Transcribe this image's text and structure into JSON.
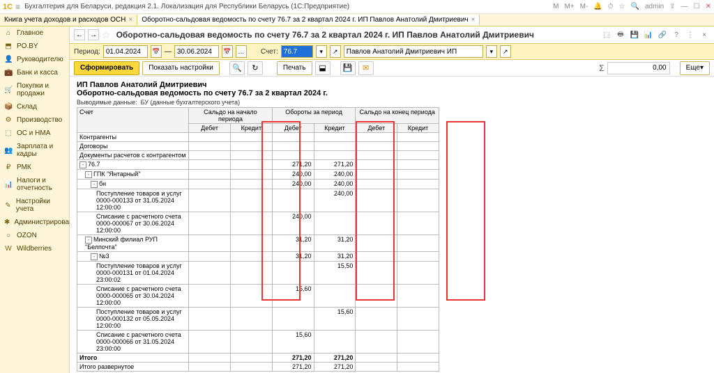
{
  "app": {
    "title": "Бухгалтерия для Беларуси, редакция 2.1. Локализация для Республики Беларусь   (1С:Предприятие)",
    "user": "admin",
    "m_labels": [
      "M",
      "M+",
      "M-"
    ]
  },
  "tabs": [
    {
      "label": "Книга учета доходов и расходов ОСН"
    },
    {
      "label": "Оборотно-сальдовая ведомость по счету 76.7 за 2 квартал 2024 г. ИП Павлов Анатолий Дмитриевич"
    }
  ],
  "sidebar": [
    {
      "icon": "⌂",
      "label": "Главное"
    },
    {
      "icon": "⬒",
      "label": "PO.BY"
    },
    {
      "icon": "👤",
      "label": "Руководителю"
    },
    {
      "icon": "💼",
      "label": "Банк и касса"
    },
    {
      "icon": "🛒",
      "label": "Покупки и продажи"
    },
    {
      "icon": "📦",
      "label": "Склад"
    },
    {
      "icon": "⚙",
      "label": "Производство"
    },
    {
      "icon": "⬚",
      "label": "ОС и НМА"
    },
    {
      "icon": "👥",
      "label": "Зарплата и кадры"
    },
    {
      "icon": "₽",
      "label": "РМК"
    },
    {
      "icon": "📊",
      "label": "Налоги и отчетность"
    },
    {
      "icon": "✎",
      "label": "Настройки учета"
    },
    {
      "icon": "✱",
      "label": "Администрирование"
    },
    {
      "icon": "○",
      "label": "OZON"
    },
    {
      "icon": "W",
      "label": "Wildberries"
    }
  ],
  "doc": {
    "title": "Оборотно-сальдовая ведомость по счету 76.7 за 2 квартал 2024 г. ИП Павлов Анатолий Дмитриевич"
  },
  "params": {
    "period_label": "Период:",
    "date_from": "01.04.2024",
    "date_to": "30.06.2024",
    "dash": "—",
    "account_label": "Счет:",
    "account": "76.7",
    "org": "Павлов Анатолий Дмитриевич ИП"
  },
  "toolbar": {
    "generate": "Сформировать",
    "show_settings": "Показать настройки",
    "print": "Печать",
    "sum_value": "0,00",
    "more": "Еще"
  },
  "report": {
    "org": "ИП Павлов Анатолий Дмитриевич",
    "title": "Оборотно-сальдовая ведомость по счету 76.7 за 2 квартал 2024 г.",
    "meta_label": "Выводимые данные:",
    "meta_value": "БУ (данные бухгалтерского учета)",
    "headers": {
      "account": "Счет",
      "counterparties": "Контрагенты",
      "contracts": "Договоры",
      "docs": "Документы расчетов с контрагентом",
      "open": "Сальдо на начало периода",
      "turn": "Обороты за период",
      "close": "Сальдо на конец периода",
      "debit": "Дебет",
      "credit": "Кредит"
    },
    "rows": [
      {
        "indent": 0,
        "tree": "-",
        "label": "76.7",
        "td": "",
        "tc": "",
        "od": "271,20",
        "oc": "271,20"
      },
      {
        "indent": 1,
        "tree": "-",
        "label": "ГПК \"Янтарный\"",
        "od": "240,00",
        "oc": "240,00"
      },
      {
        "indent": 2,
        "tree": "-",
        "label": "бн",
        "od": "240,00",
        "oc": "240,00"
      },
      {
        "indent": 3,
        "label": "Поступление товаров и услуг 0000-000133 от 31.05.2024 12:00:00",
        "oc": "240,00"
      },
      {
        "indent": 3,
        "label": "Списание с расчетного счета 0000-000067 от 30.06.2024 12:00:00",
        "od": "240,00"
      },
      {
        "indent": 1,
        "tree": "-",
        "label": "Минский филиал РУП \"Белпочта\"",
        "od": "31,20",
        "oc": "31,20"
      },
      {
        "indent": 2,
        "tree": "-",
        "label": "№3",
        "od": "31,20",
        "oc": "31,20"
      },
      {
        "indent": 3,
        "label": "Поступление товаров и услуг 0000-000131 от 01.04.2024 23:00:02",
        "oc": "15,50"
      },
      {
        "indent": 3,
        "label": "Списание с расчетного счета 0000-000065 от 30.04.2024 12:00:00",
        "od": "15,60"
      },
      {
        "indent": 3,
        "label": "Поступление товаров и услуг 0000-000132 от 05.05.2024 12:00:00",
        "oc": "15,60"
      },
      {
        "indent": 3,
        "label": "Списание с расчетного счета 0000-000066 от 31.05.2024 23:00:00",
        "od": "15,60"
      }
    ],
    "totals": {
      "itogo_label": "Итого",
      "itogo_od": "271,20",
      "itogo_oc": "271,20",
      "expanded_label": "Итого развернутое",
      "expanded_od": "271,20",
      "expanded_oc": "271,20"
    }
  }
}
